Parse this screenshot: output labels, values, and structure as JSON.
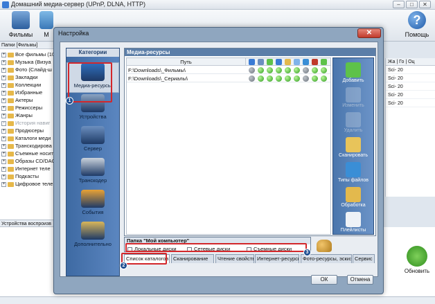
{
  "window": {
    "title": "Домашний медиа-сервер (UPnP, DLNA, HTTP)"
  },
  "toolbar": {
    "films_label": "Фильмы",
    "m_label": "М",
    "help_label": "Помощь"
  },
  "left_panel": {
    "header": "Папки [Фильмы]",
    "items": [
      {
        "label": "Все фильмы (10",
        "grey": false
      },
      {
        "label": "Музыка (Визуа",
        "grey": false
      },
      {
        "label": "Фото (Слайд-ш",
        "grey": false
      },
      {
        "label": "Закладки",
        "grey": false
      },
      {
        "label": "Коллекции",
        "grey": false
      },
      {
        "label": "Избранные",
        "grey": false
      },
      {
        "label": "Актеры",
        "grey": false
      },
      {
        "label": "Режиссеры",
        "grey": false
      },
      {
        "label": "Жанры",
        "grey": false
      },
      {
        "label": "История навиг",
        "grey": true
      },
      {
        "label": "Продюсеры",
        "grey": false
      },
      {
        "label": "Каталоги меди",
        "grey": false
      },
      {
        "label": "Транскодирова",
        "grey": false
      },
      {
        "label": "Съемные носит",
        "grey": false
      },
      {
        "label": "Образы CD/DAC",
        "grey": false
      },
      {
        "label": "Интернет теле",
        "grey": false
      },
      {
        "label": "Подкасты",
        "grey": false
      },
      {
        "label": "Цифровое теле",
        "grey": false
      }
    ],
    "devices_label": "Устройства воспроизв"
  },
  "right_columns": {
    "headers": [
      "Жа",
      "Го",
      "Оц"
    ],
    "rows": [
      "Sci- 20",
      "Sci- 20",
      "Sci- 20",
      "Sci- 20",
      "Sci- 20"
    ]
  },
  "refresh_label": "Обновить",
  "dialog": {
    "title": "Настройка",
    "close": "✕",
    "categories_header": "Категории",
    "categories": [
      {
        "label": "Медиа-ресурсы",
        "selected": true,
        "color": "#2f6fbf"
      },
      {
        "label": "Устройства",
        "selected": false,
        "color": "#8aa3c2"
      },
      {
        "label": "Сервер",
        "selected": false,
        "color": "#6b8fbf"
      },
      {
        "label": "Транскодер",
        "selected": false,
        "color": "#c9d2dc"
      },
      {
        "label": "События",
        "selected": false,
        "color": "#e8a236"
      },
      {
        "label": "Дополнительно",
        "selected": false,
        "color": "#d9b65a"
      }
    ],
    "media_header": "Медиа-ресурсы",
    "path_header": "Путь",
    "rows": [
      {
        "path": "F:\\Downloads\\_Фильмы\\",
        "flags": [
          "d",
          "g",
          "g",
          "g",
          "g",
          "g",
          "d",
          "g",
          "g"
        ]
      },
      {
        "path": "F:\\Downloads\\_Сериалы\\",
        "flags": [
          "d",
          "g",
          "g",
          "g",
          "g",
          "g",
          "d",
          "g",
          "g"
        ]
      }
    ],
    "actions": [
      {
        "label": "Добавить",
        "disabled": false,
        "color": "#5ec24a"
      },
      {
        "label": "Изменить",
        "disabled": true,
        "color": "#c9d4e2"
      },
      {
        "label": "Удалить",
        "disabled": true,
        "color": "#c9d4e2"
      },
      {
        "label": "Сканировать",
        "disabled": false,
        "color": "#e8c45a"
      },
      {
        "label": "Типы файлов",
        "disabled": false,
        "color": "#3a8ed6"
      },
      {
        "label": "Обработка",
        "disabled": false,
        "color": "#e3b94d"
      },
      {
        "label": "Плейлисты",
        "disabled": false,
        "color": "#eef2f7"
      }
    ],
    "my_computer": {
      "header": "Папка \"Мой компьютер\"",
      "local": "Локальные диски",
      "network": "Сетевые диски",
      "removable": "Съемные диски"
    },
    "tabs": [
      "Список каталогов",
      "Сканирование",
      "Чтение свойств",
      "Интернет-ресурсы",
      "Фото-ресурсы, эскизы",
      "Сервис"
    ],
    "ok": "ОК",
    "cancel": "Отмена"
  },
  "annotations": {
    "badge1": "1",
    "badge2": "2",
    "badge3": "3"
  },
  "colors": {
    "dialog_bg": "#8fa6bf",
    "accent_red": "#d3262a",
    "header_blue": "#5b7ea8",
    "status_green": "#2e9d1b"
  }
}
